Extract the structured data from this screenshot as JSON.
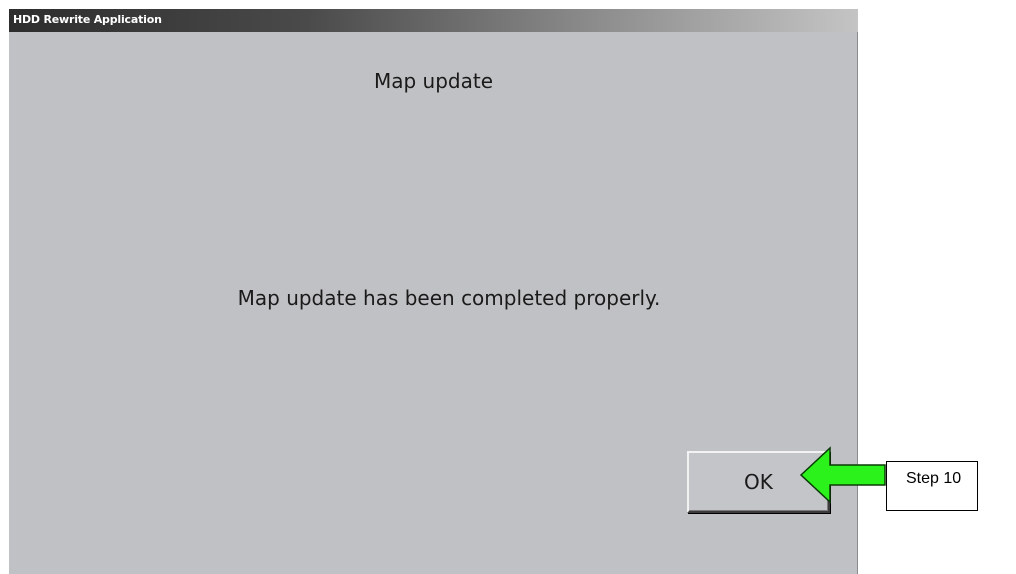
{
  "window": {
    "title": "HDD Rewrite Application"
  },
  "dialog": {
    "heading": "Map update",
    "message": "Map update has been completed properly.",
    "ok_label": "OK"
  },
  "annotation": {
    "callout_text": "Step 10",
    "arrow_icon": "left-arrow-icon",
    "arrow_color": "#2bf21a"
  },
  "colors": {
    "window_background": "#c0c1c4",
    "titlebar_dark": "#2d2d2d"
  }
}
